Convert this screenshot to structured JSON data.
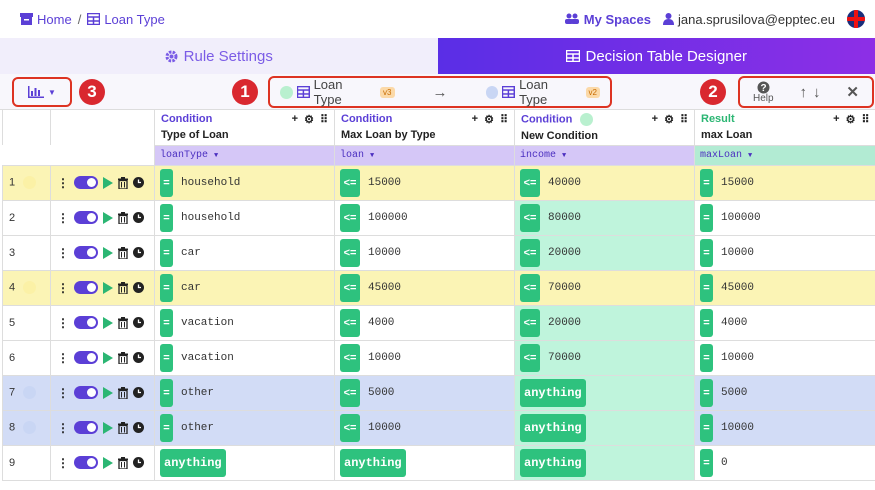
{
  "breadcrumb": {
    "home": "Home",
    "separator": "/",
    "current": "Loan Type"
  },
  "topright": {
    "my_spaces": "My Spaces",
    "user": "jana.sprusilova@epptec.eu"
  },
  "tabs": {
    "rule_settings": "Rule Settings",
    "designer": "Decision Table Designer"
  },
  "toolbar": {
    "badge1": "1",
    "badge2": "2",
    "badge3": "3",
    "version_from": {
      "name": "Loan Type",
      "tag": "v3",
      "dot_color": "#b9f0cf"
    },
    "version_to": {
      "name": "Loan Type",
      "tag": "v2",
      "dot_color": "#c9d6f4"
    },
    "help": "Help"
  },
  "columns": [
    {
      "type": "Condition",
      "name": "Type of Loan",
      "field": "loanType"
    },
    {
      "type": "Condition",
      "name": "Max Loan by Type",
      "field": "loan"
    },
    {
      "type": "Condition",
      "name": "New Condition",
      "field": "income"
    },
    {
      "type": "Result",
      "name": "max Loan",
      "field": "maxLoan"
    }
  ],
  "rows": [
    {
      "num": "1",
      "marker": "yellow",
      "c1": {
        "op": "=",
        "val": "household"
      },
      "c2": {
        "op": "<=",
        "val": "15000"
      },
      "c3": {
        "op": "<=",
        "val": "40000"
      },
      "c4": {
        "op": "=",
        "val": "15000"
      },
      "bg": "yellow"
    },
    {
      "num": "2",
      "marker": "",
      "c1": {
        "op": "=",
        "val": "household"
      },
      "c2": {
        "op": "<=",
        "val": "100000"
      },
      "c3": {
        "op": "<=",
        "val": "80000"
      },
      "c4": {
        "op": "=",
        "val": "100000"
      },
      "bg": ""
    },
    {
      "num": "3",
      "marker": "",
      "c1": {
        "op": "=",
        "val": "car"
      },
      "c2": {
        "op": "<=",
        "val": "10000"
      },
      "c3": {
        "op": "<=",
        "val": "20000"
      },
      "c4": {
        "op": "=",
        "val": "10000"
      },
      "bg": ""
    },
    {
      "num": "4",
      "marker": "yellow",
      "c1": {
        "op": "=",
        "val": "car"
      },
      "c2": {
        "op": "<=",
        "val": "45000"
      },
      "c3": {
        "op": "<=",
        "val": "70000"
      },
      "c4": {
        "op": "=",
        "val": "45000"
      },
      "bg": "yellow"
    },
    {
      "num": "5",
      "marker": "",
      "c1": {
        "op": "=",
        "val": "vacation"
      },
      "c2": {
        "op": "<=",
        "val": "4000"
      },
      "c3": {
        "op": "<=",
        "val": "20000"
      },
      "c4": {
        "op": "=",
        "val": "4000"
      },
      "bg": ""
    },
    {
      "num": "6",
      "marker": "",
      "c1": {
        "op": "=",
        "val": "vacation"
      },
      "c2": {
        "op": "<=",
        "val": "10000"
      },
      "c3": {
        "op": "<=",
        "val": "70000"
      },
      "c4": {
        "op": "=",
        "val": "10000"
      },
      "bg": ""
    },
    {
      "num": "7",
      "marker": "blue",
      "c1": {
        "op": "=",
        "val": "other"
      },
      "c2": {
        "op": "<=",
        "val": "5000"
      },
      "c3": {
        "anything": "anything"
      },
      "c4": {
        "op": "=",
        "val": "5000"
      },
      "bg": "blue"
    },
    {
      "num": "8",
      "marker": "blue",
      "c1": {
        "op": "=",
        "val": "other"
      },
      "c2": {
        "op": "<=",
        "val": "10000"
      },
      "c3": {
        "anything": "anything"
      },
      "c4": {
        "op": "=",
        "val": "10000"
      },
      "bg": "blue"
    },
    {
      "num": "9",
      "marker": "",
      "c1": {
        "anything": "anything"
      },
      "c2": {
        "anything": "anything"
      },
      "c3": {
        "anything": "anything"
      },
      "c4": {
        "op": "=",
        "val": "0"
      },
      "bg": ""
    }
  ]
}
